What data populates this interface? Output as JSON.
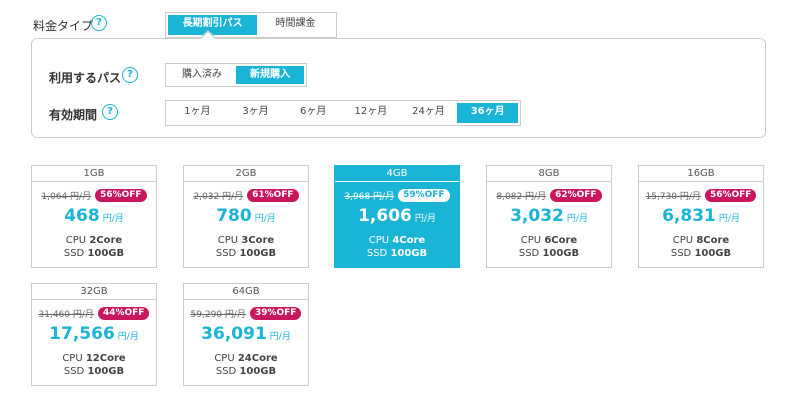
{
  "fee_type": {
    "label": "料金タイプ",
    "options": [
      "長期割引パス",
      "時間課金"
    ],
    "selected": "長期割引パス"
  },
  "pass_section": {
    "use_pass": {
      "label": "利用するパス",
      "options": [
        "購入済み",
        "新規購入"
      ],
      "selected": "新規購入"
    },
    "validity": {
      "label": "有効期間",
      "options": [
        "1ヶ月",
        "3ヶ月",
        "6ヶ月",
        "12ヶ月",
        "24ヶ月",
        "36ヶ月"
      ],
      "selected": "36ヶ月"
    }
  },
  "help_icon": "?",
  "plans": [
    {
      "name": "1GB",
      "original": "1,064 円/月",
      "discount": "56%OFF",
      "price": "468",
      "unit": "円/月",
      "cpu_label": "CPU",
      "cpu": "2Core",
      "ssd_label": "SSD",
      "ssd": "100GB"
    },
    {
      "name": "2GB",
      "original": "2,032 円/月",
      "discount": "61%OFF",
      "price": "780",
      "unit": "円/月",
      "cpu_label": "CPU",
      "cpu": "3Core",
      "ssd_label": "SSD",
      "ssd": "100GB"
    },
    {
      "name": "4GB",
      "original": "3,968 円/月",
      "discount": "59%OFF",
      "price": "1,606",
      "unit": "円/月",
      "cpu_label": "CPU",
      "cpu": "4Core",
      "ssd_label": "SSD",
      "ssd": "100GB"
    },
    {
      "name": "8GB",
      "original": "8,082 円/月",
      "discount": "62%OFF",
      "price": "3,032",
      "unit": "円/月",
      "cpu_label": "CPU",
      "cpu": "6Core",
      "ssd_label": "SSD",
      "ssd": "100GB"
    },
    {
      "name": "16GB",
      "original": "15,730 円/月",
      "discount": "56%OFF",
      "price": "6,831",
      "unit": "円/月",
      "cpu_label": "CPU",
      "cpu": "8Core",
      "ssd_label": "SSD",
      "ssd": "100GB"
    },
    {
      "name": "32GB",
      "original": "31,460 円/月",
      "discount": "44%OFF",
      "price": "17,566",
      "unit": "円/月",
      "cpu_label": "CPU",
      "cpu": "12Core",
      "ssd_label": "SSD",
      "ssd": "100GB"
    },
    {
      "name": "64GB",
      "original": "59,290 円/月",
      "discount": "39%OFF",
      "price": "36,091",
      "unit": "円/月",
      "cpu_label": "CPU",
      "cpu": "24Core",
      "ssd_label": "SSD",
      "ssd": "100GB"
    }
  ],
  "selected_plan": "4GB",
  "colors": {
    "accent": "#1ab4d7",
    "badge": "#c8175d",
    "border": "#cccccc"
  }
}
